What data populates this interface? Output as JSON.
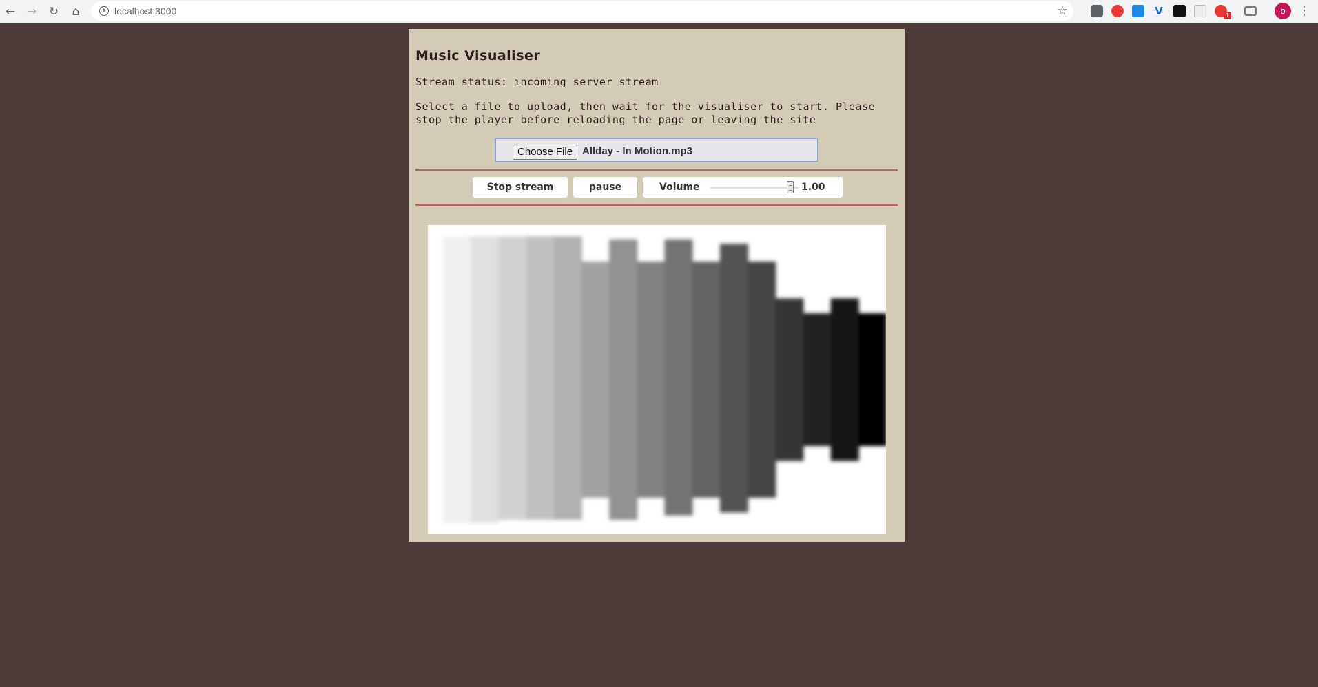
{
  "browser": {
    "url": "localhost:3000",
    "profile_initial": "b",
    "extensions": [
      "shield-extension-icon",
      "red-extension-icon",
      "blue-extension-icon",
      "v-extension-icon",
      "amazon-extension-icon",
      "gray-extension-icon",
      "grammarly-extension-icon",
      "camera-extension-icon"
    ],
    "badge_count": "1"
  },
  "app": {
    "title": "Music Visualiser",
    "stream_status": "Stream status: incoming server stream",
    "instructions": "Select a file to upload, then wait for the visualiser to start. Please stop the player before reloading the page or leaving the site",
    "file_input": {
      "button_label": "Choose File",
      "filename": "Allday - In Motion.mp3"
    },
    "controls": {
      "stop_label": "Stop stream",
      "pause_label": "pause",
      "volume_label": "Volume",
      "volume_value": "1.00",
      "volume_level": 1.0
    },
    "visualiser": {
      "bar_count": 16,
      "top_levels": [
        0.97,
        0.97,
        0.97,
        0.97,
        0.97,
        0.8,
        0.95,
        0.8,
        0.95,
        0.8,
        0.92,
        0.8,
        0.55,
        0.45,
        0.55,
        0.45
      ],
      "bottom_levels": [
        0.97,
        0.97,
        0.95,
        0.95,
        0.95,
        0.8,
        0.95,
        0.8,
        0.92,
        0.8,
        0.9,
        0.8,
        0.55,
        0.45,
        0.55,
        0.45
      ]
    }
  },
  "colors": {
    "page_bg": "#4f3a3a",
    "panel_bg": "#d4cbb7",
    "divider": "#b06a60",
    "text": "#2b1c1a"
  }
}
